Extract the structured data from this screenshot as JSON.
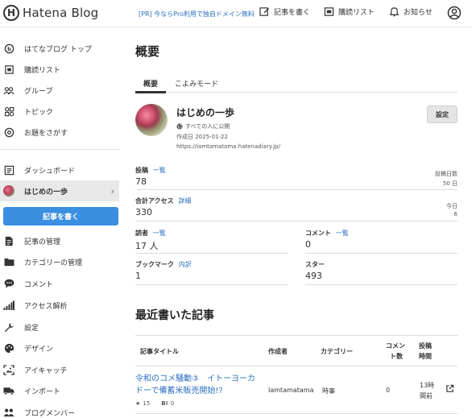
{
  "header": {
    "logo_mark": "H",
    "logo_text": "Hatena Blog",
    "promo": "[PR] 今ならPro利用で独自ドメイン無料",
    "write": "記事を書く",
    "subscriptions": "購読リスト",
    "notifications": "お知らせ"
  },
  "sidebar": {
    "items": [
      {
        "label": "はてなブログ トップ",
        "icon": "hatena-icon"
      },
      {
        "label": "購読リスト",
        "icon": "subscription-icon"
      },
      {
        "label": "グループ",
        "icon": "group-icon"
      },
      {
        "label": "トピック",
        "icon": "topic-icon"
      },
      {
        "label": "お題をさがす",
        "icon": "search-topic-icon"
      },
      {
        "label": "ダッシュボード",
        "icon": "dashboard-icon"
      },
      {
        "label": "はじめの一歩",
        "icon": "blog-avatar"
      },
      {
        "label": "記事の管理",
        "icon": "document-icon"
      },
      {
        "label": "カテゴリーの管理",
        "icon": "folder-icon"
      },
      {
        "label": "コメント",
        "icon": "comment-icon"
      },
      {
        "label": "アクセス解析",
        "icon": "bar-chart-icon"
      },
      {
        "label": "設定",
        "icon": "wrench-icon"
      },
      {
        "label": "デザイン",
        "icon": "palette-icon"
      },
      {
        "label": "アイキャッチ",
        "icon": "eyecatch-icon"
      },
      {
        "label": "インポート",
        "icon": "truck-icon"
      },
      {
        "label": "ブログメンバー",
        "icon": "members-icon"
      }
    ],
    "write_button": "記事を書く"
  },
  "main": {
    "title": "概要",
    "tabs": [
      {
        "label": "概要",
        "active": true
      },
      {
        "label": "こよみモード",
        "active": false
      }
    ],
    "blog": {
      "title": "はじめの一歩",
      "visibility": "すべての人に公開",
      "created": "作成日 2025-01-22",
      "url": "https://iamtamatama.hatenadiary.jp/",
      "settings_button": "設定"
    },
    "stats": {
      "posts_label": "投稿",
      "posts_link": "一覧",
      "posts_value": "78",
      "post_days_label": "投稿日数",
      "post_days_value": "50 日",
      "access_label": "合計アクセス",
      "access_link": "詳細",
      "access_value": "330",
      "today_label": "今日",
      "today_value": "6",
      "readers_label": "読者",
      "readers_link": "一覧",
      "readers_value": "17 人",
      "comments_label": "コメント",
      "comments_link": "一覧",
      "comments_value": "0",
      "bookmarks_label": "ブックマーク",
      "bookmarks_link": "内訳",
      "bookmarks_value": "1",
      "stars_label": "スター",
      "stars_value": "493"
    },
    "recent": {
      "title": "最近書いた記事",
      "columns": {
        "title": "記事タイトル",
        "author": "作成者",
        "category": "カテゴリー",
        "comments_line1": "コメン",
        "comments_line2": "ト数",
        "posted_line1": "投稿",
        "posted_line2": "時間"
      },
      "rows": [
        {
          "title": "令和のコメ騒動③　イトーヨーカドーで備蓄米販売開始!?",
          "author": "Iamtamatama",
          "category": "時事",
          "comments": "0",
          "posted_line1": "13時",
          "posted_line2": "間前",
          "stars": "15",
          "bookmark_label": "B!",
          "bookmarks": "0"
        }
      ]
    }
  },
  "colors": {
    "accent": "#3a8fe0",
    "link": "#2a6fbf",
    "active_bg": "#e8e8e8"
  }
}
